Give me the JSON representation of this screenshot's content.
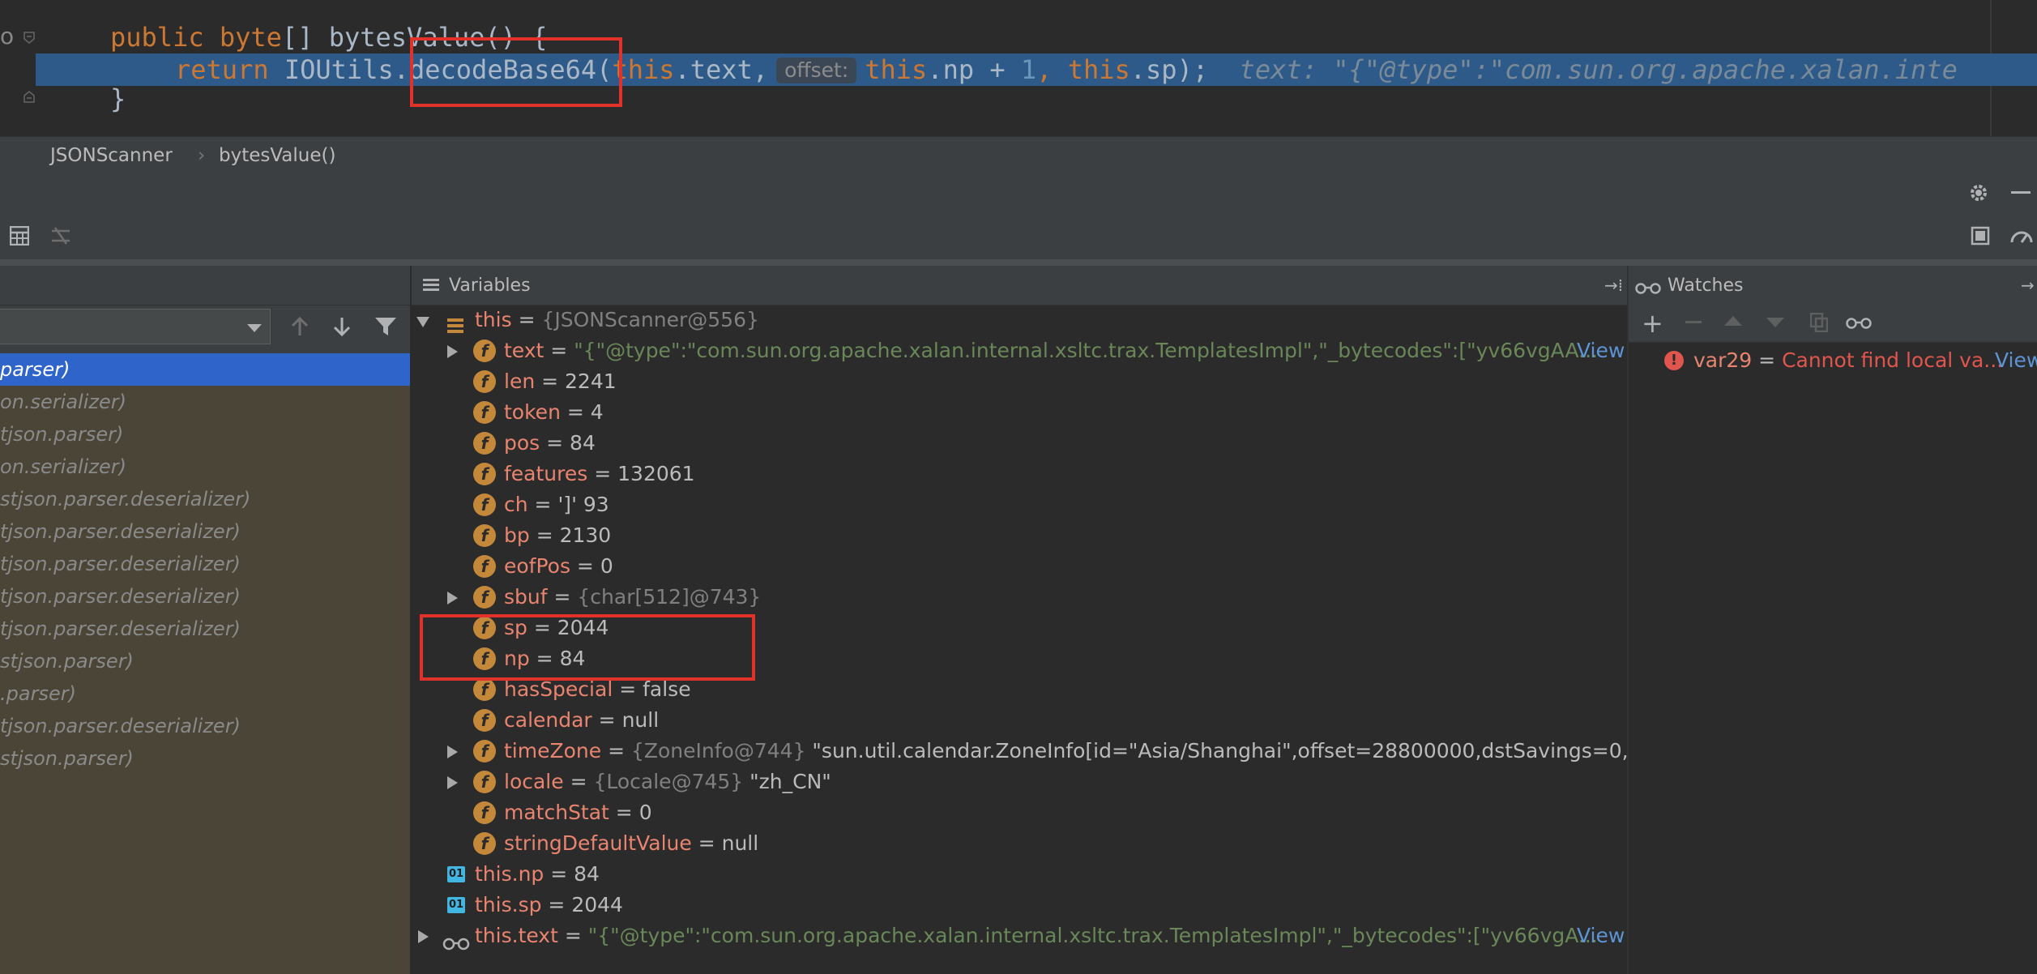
{
  "editor": {
    "line1": {
      "kw1": "public",
      "kw2": "byte",
      "rest": "[] bytesValue() {"
    },
    "line2": {
      "kw_return": "return",
      "cls": "IOUtils.",
      "method": "decodeBase64",
      "paren": "(",
      "kw_this1": "this",
      "field_text": ".text,",
      "hint_offset": "offset:",
      "kw_this2": "this",
      "field_np": ".np + ",
      "num_one": "1",
      "comma": ",",
      "kw_this3": "this",
      "field_sp": ".sp);",
      "inline_label": "text:",
      "inline_value": "\"{\"@type\":\"com.sun.org.apache.xalan.inte"
    },
    "line3": "}"
  },
  "breadcrumb": {
    "item1": "JSONScanner",
    "separator": "›",
    "item2": "bytesValue()"
  },
  "frames": {
    "items": [
      {
        "label": "parser)",
        "selected": true
      },
      {
        "label": "on.serializer)"
      },
      {
        "label": "tjson.parser)"
      },
      {
        "label": "on.serializer)"
      },
      {
        "label": "stjson.parser.deserializer)"
      },
      {
        "label": "tjson.parser.deserializer)"
      },
      {
        "label": "tjson.parser.deserializer)"
      },
      {
        "label": "tjson.parser.deserializer)"
      },
      {
        "label": "tjson.parser.deserializer)"
      },
      {
        "label": "stjson.parser)"
      },
      {
        "label": ".parser)"
      },
      {
        "label": "tjson.parser.deserializer)"
      },
      {
        "label": "stjson.parser)"
      }
    ]
  },
  "variables": {
    "title": "Variables",
    "this_row": {
      "name": "this",
      "eq": " = ",
      "value": "{JSONScanner@556}"
    },
    "fields": [
      {
        "name": "text",
        "eq": " = ",
        "value": "\"{\"@type\":\"com.sun.org.apache.xalan.internal.xsltc.trax.TemplatesImpl\",\"_bytecodes\":[\"yv66vgAA...",
        "kind": "str",
        "link": "View",
        "expandable": true
      },
      {
        "name": "len",
        "eq": " = ",
        "value": "2241",
        "kind": "val"
      },
      {
        "name": "token",
        "eq": " = ",
        "value": "4",
        "kind": "val"
      },
      {
        "name": "pos",
        "eq": " = ",
        "value": "84",
        "kind": "val"
      },
      {
        "name": "features",
        "eq": " = ",
        "value": "132061",
        "kind": "val"
      },
      {
        "name": "ch",
        "eq": " = ",
        "value": "']' 93",
        "kind": "val"
      },
      {
        "name": "bp",
        "eq": " = ",
        "value": "2130",
        "kind": "val"
      },
      {
        "name": "eofPos",
        "eq": " = ",
        "value": "0",
        "kind": "val"
      },
      {
        "name": "sbuf",
        "eq": " = ",
        "value": "{char[512]@743}",
        "kind": "gray",
        "expandable": true
      },
      {
        "name": "sp",
        "eq": " = ",
        "value": "2044",
        "kind": "val"
      },
      {
        "name": "np",
        "eq": " = ",
        "value": "84",
        "kind": "val"
      },
      {
        "name": "hasSpecial",
        "eq": " = ",
        "value": "false",
        "kind": "val"
      },
      {
        "name": "calendar",
        "eq": " = ",
        "value": "null",
        "kind": "val"
      },
      {
        "name": "timeZone",
        "eq": " = ",
        "ref": "{ZoneInfo@744} ",
        "value": "\"sun.util.calendar.ZoneInfo[id=\"Asia/Shanghai\",offset=28800000,dstSavings=0,use",
        "kind": "val",
        "expandable": true
      },
      {
        "name": "locale",
        "eq": " = ",
        "ref": "{Locale@745} ",
        "value": "\"zh_CN\"",
        "kind": "val",
        "expandable": true
      },
      {
        "name": "matchStat",
        "eq": " = ",
        "value": "0",
        "kind": "val"
      },
      {
        "name": "stringDefaultValue",
        "eq": " = ",
        "value": "null",
        "kind": "val"
      }
    ],
    "exprs": [
      {
        "name": "this.np",
        "eq": " = ",
        "value": "84",
        "icon": "01"
      },
      {
        "name": "this.sp",
        "eq": " = ",
        "value": "2044",
        "icon": "01"
      }
    ],
    "watch_row": {
      "name": "this.text",
      "eq": " = ",
      "value": "\"{\"@type\":\"com.sun.org.apache.xalan.internal.xsltc.trax.TemplatesImpl\",\"_bytecodes\":[\"yv66vgA...",
      "link": "View"
    }
  },
  "watches": {
    "title": "Watches",
    "items": [
      {
        "name": "var29",
        "eq": " = ",
        "value": "Cannot find local va...",
        "link": "View"
      }
    ]
  },
  "colors": {
    "accent": "#2f65ca",
    "error": "#e0564f",
    "highlight_box": "#e0312b",
    "exec_line": "#2d5a88"
  }
}
